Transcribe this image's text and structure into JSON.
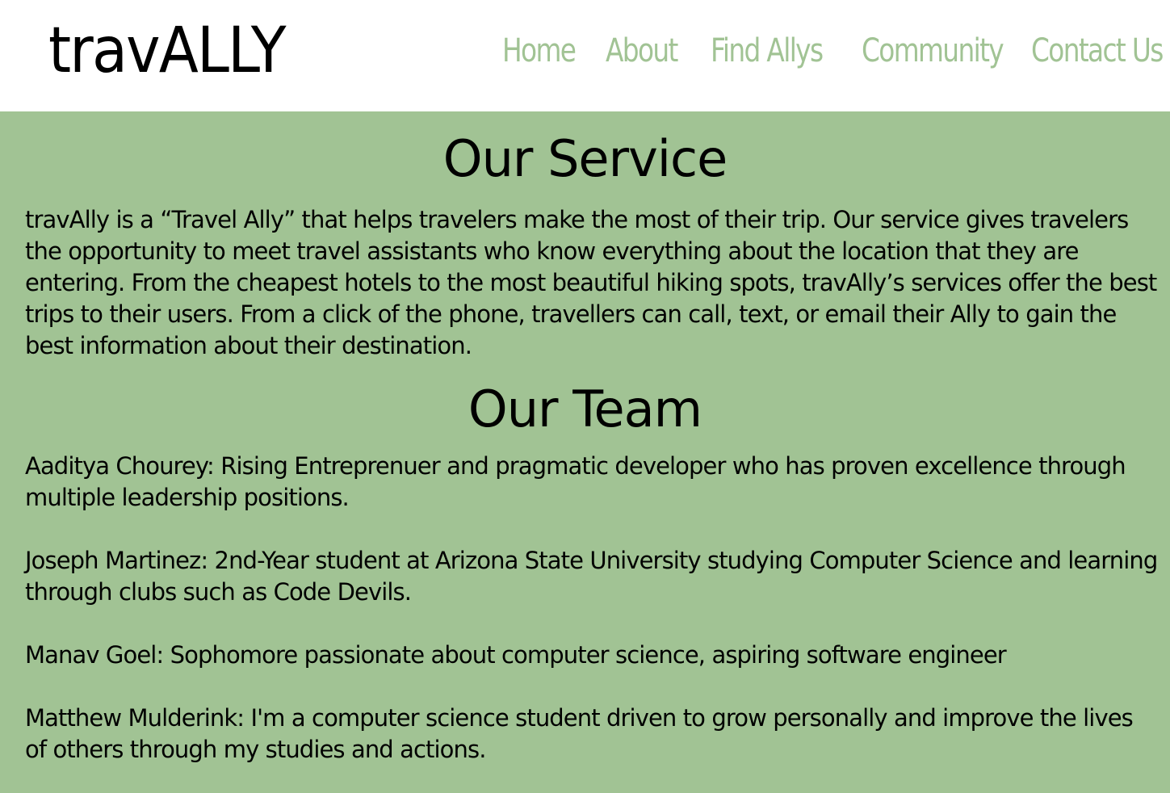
{
  "header": {
    "logo": "travALLY",
    "nav": [
      {
        "label": "Home"
      },
      {
        "label": "About"
      },
      {
        "label": "Find Allys"
      },
      {
        "label": "Community"
      },
      {
        "label": "Contact Us"
      }
    ]
  },
  "service": {
    "heading": "Our Service",
    "text": "travAlly is a “Travel Ally” that helps travelers make the most of their trip. Our service gives travelers the opportunity to meet travel assistants who know everything about the location that they are entering. From the cheapest hotels to the most beautiful hiking spots, travAlly’s services offer the best trips to their users. From a click of the phone, travellers can call, text, or email their Ally to gain the best information about their destination."
  },
  "team": {
    "heading": "Our Team",
    "members": [
      {
        "text": "Aaditya Chourey: Rising Entreprenuer and pragmatic developer who has proven excellence through multiple leadership positions."
      },
      {
        "text": "Joseph Martinez: 2nd-Year student at Arizona State University studying Computer Science and learning through clubs such as Code Devils."
      },
      {
        "text": "Manav Goel: Sophomore passionate about computer science, aspiring software engineer"
      },
      {
        "text": "Matthew Mulderink: I'm a computer science student driven to grow personally and improve the lives of others through my studies and actions."
      }
    ]
  },
  "colors": {
    "accent": "#a1c394",
    "header_bg": "#ffffff",
    "text": "#000000"
  }
}
